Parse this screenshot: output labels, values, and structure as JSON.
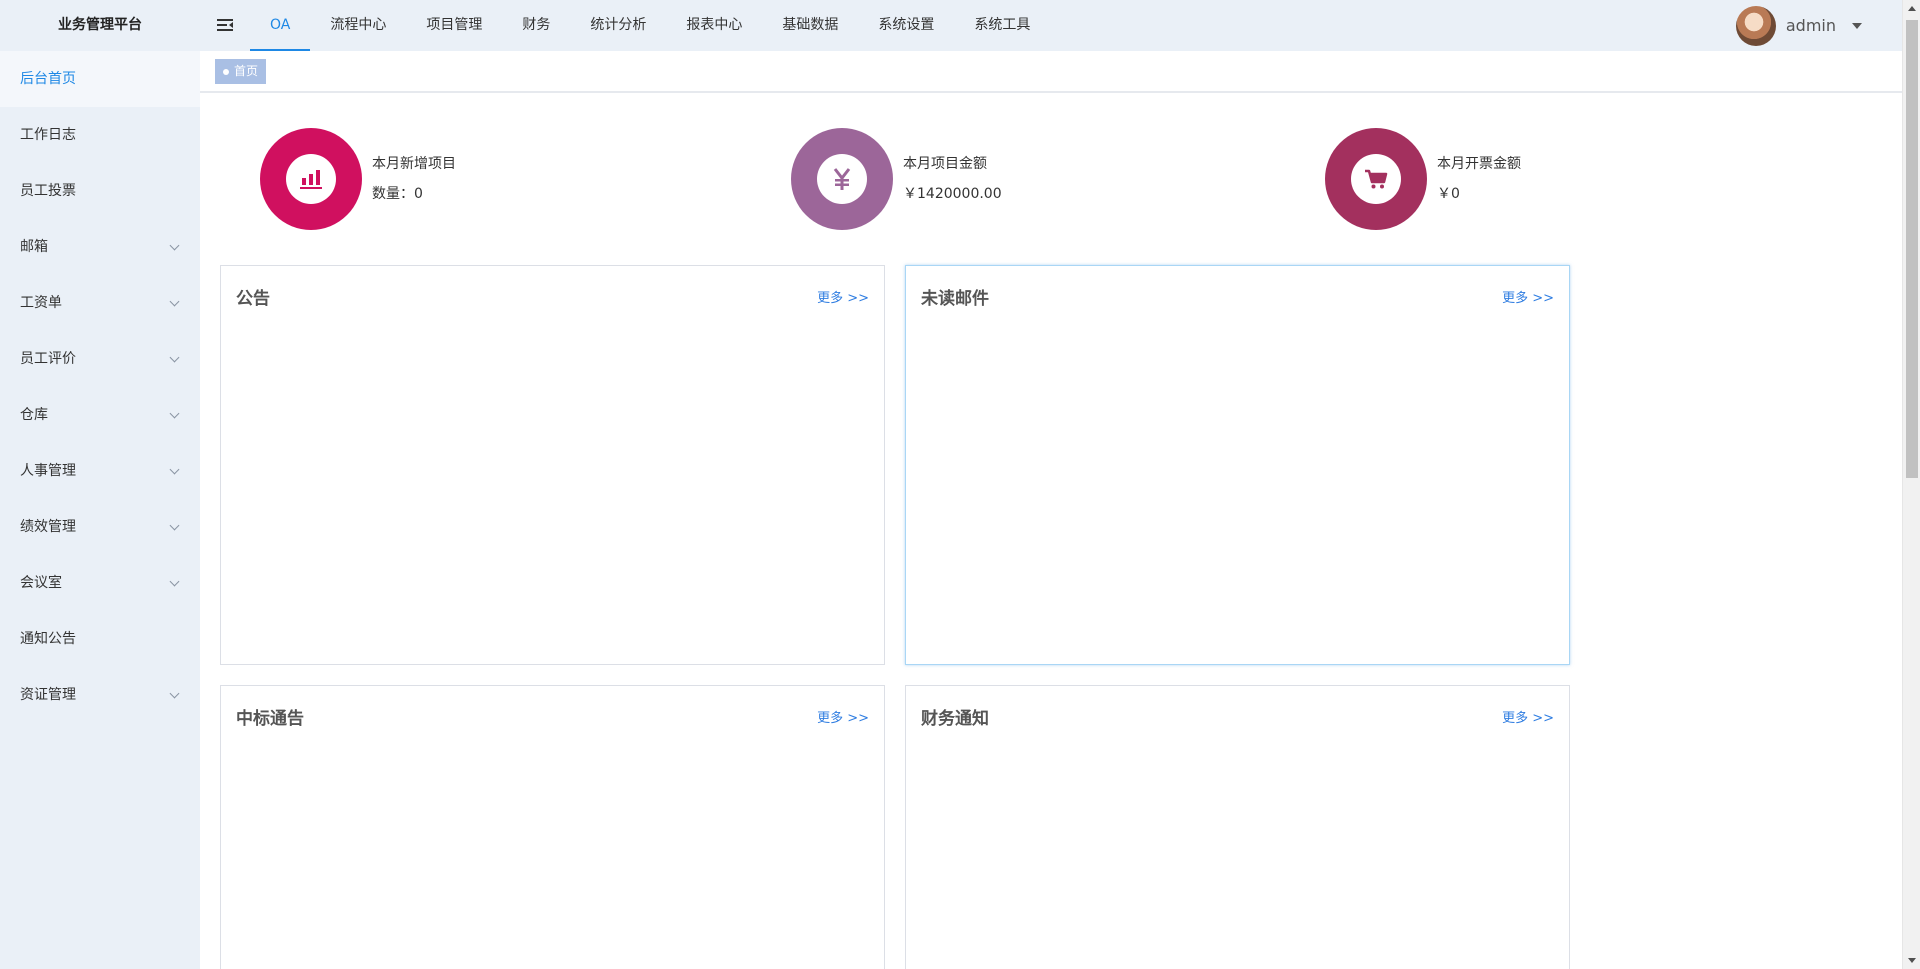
{
  "header": {
    "brand": "业务管理平台",
    "nav": [
      {
        "label": "OA",
        "active": true
      },
      {
        "label": "流程中心"
      },
      {
        "label": "项目管理"
      },
      {
        "label": "财务"
      },
      {
        "label": "统计分析"
      },
      {
        "label": "报表中心"
      },
      {
        "label": "基础数据"
      },
      {
        "label": "系统设置"
      },
      {
        "label": "系统工具"
      }
    ],
    "user": {
      "name": "admin"
    }
  },
  "sidebar": {
    "items": [
      {
        "label": "后台首页",
        "active": true,
        "has_children": false
      },
      {
        "label": "工作日志",
        "has_children": false
      },
      {
        "label": "员工投票",
        "has_children": false
      },
      {
        "label": "邮箱",
        "has_children": true
      },
      {
        "label": "工资单",
        "has_children": true
      },
      {
        "label": "员工评价",
        "has_children": true
      },
      {
        "label": "仓库",
        "has_children": true
      },
      {
        "label": "人事管理",
        "has_children": true
      },
      {
        "label": "绩效管理",
        "has_children": true
      },
      {
        "label": "会议室",
        "has_children": true
      },
      {
        "label": "通知公告",
        "has_children": false
      },
      {
        "label": "资证管理",
        "has_children": true
      }
    ]
  },
  "breadcrumb": {
    "tab": "首页"
  },
  "stats": [
    {
      "title": "本月新增项目",
      "value": "数量：0",
      "icon": "bar-chart-podium-icon",
      "color": "#d0105f"
    },
    {
      "title": "本月项目金额",
      "value": "￥1420000.00",
      "icon": "yen-icon",
      "color": "#9c6699"
    },
    {
      "title": "本月开票金额",
      "value": "￥0",
      "icon": "shopping-cart-icon",
      "color": "#a3305e"
    }
  ],
  "panels": [
    {
      "title": "公告",
      "more": "更多 >>"
    },
    {
      "title": "未读邮件",
      "more": "更多 >>"
    },
    {
      "title": "中标通告",
      "more": "更多 >>"
    },
    {
      "title": "财务通知",
      "more": "更多 >>"
    }
  ],
  "colors": {
    "accent": "#1e88e5",
    "sidebar_bg": "#eaf0f7",
    "link": "#2f7de1"
  }
}
